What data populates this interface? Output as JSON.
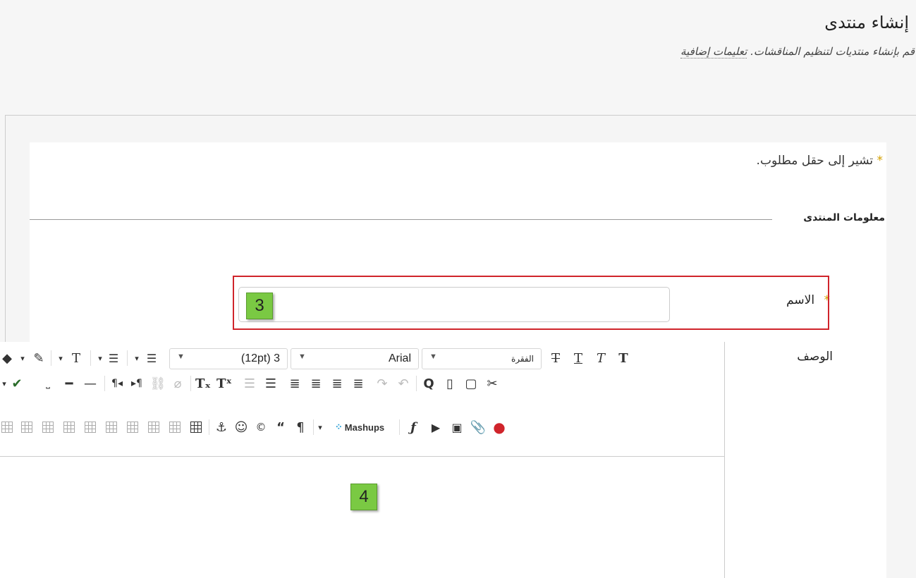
{
  "header": {
    "title": "إنشاء منتدى",
    "subtitle": "قم بإنشاء منتديات لتنظيم المناقشات.",
    "more_link": "تعليمات إضافية"
  },
  "form": {
    "required_note": "تشير إلى حقل مطلوب.",
    "required_star": "*",
    "section_title": "معلومات المنتدى",
    "name_label": "الاسم",
    "name_value": "",
    "description_label": "الوصف"
  },
  "callouts": {
    "name_number": "3",
    "editor_number": "4"
  },
  "toolbar": {
    "paragraph_value": "الفقرة",
    "font_value": "Arial",
    "size_value": "(12pt) 3",
    "mashups_label": "Mashups"
  },
  "colors": {
    "highlight_border": "#d0242b",
    "callout_green": "#7ac943",
    "required_star": "#d4a000"
  }
}
